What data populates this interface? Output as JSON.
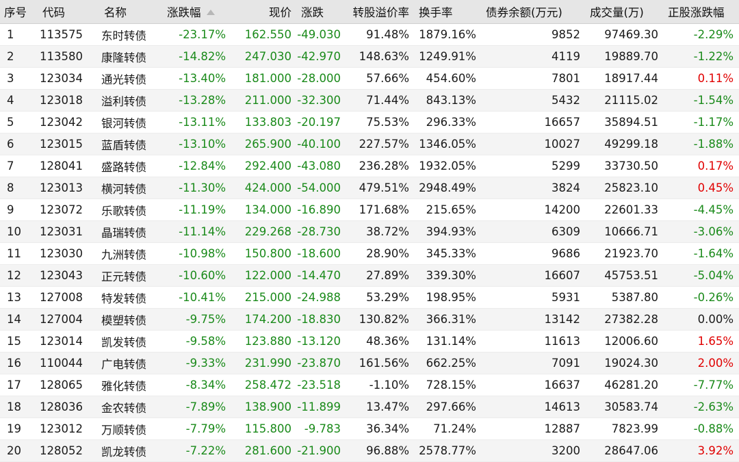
{
  "headers": [
    "序号",
    "代码",
    "名称",
    "涨跌幅",
    "现价",
    "涨跌",
    "转股溢价率",
    "换手率",
    "债券余额(万元)",
    "成交量(万)",
    "正股涨跌幅"
  ],
  "colors": {
    "down": "#1a8a1a",
    "up": "#e00000",
    "flat": "#1a1a1a"
  },
  "sort": {
    "column": "涨跌幅",
    "icon": "sort-ascending-icon"
  },
  "rows": [
    [
      "1",
      "113575",
      "东时转债",
      "-23.17%",
      "162.550",
      "-49.030",
      "91.48%",
      "1879.16%",
      "9852",
      "97469.30",
      "-2.29%"
    ],
    [
      "2",
      "113580",
      "康隆转债",
      "-14.82%",
      "247.030",
      "-42.970",
      "148.63%",
      "1249.91%",
      "4119",
      "19889.70",
      "-1.22%"
    ],
    [
      "3",
      "123034",
      "通光转债",
      "-13.40%",
      "181.000",
      "-28.000",
      "57.66%",
      "454.60%",
      "7801",
      "18917.44",
      "0.11%"
    ],
    [
      "4",
      "123018",
      "溢利转债",
      "-13.28%",
      "211.000",
      "-32.300",
      "71.44%",
      "843.13%",
      "5432",
      "21115.02",
      "-1.54%"
    ],
    [
      "5",
      "123042",
      "银河转债",
      "-13.11%",
      "133.803",
      "-20.197",
      "75.53%",
      "296.33%",
      "16657",
      "35894.51",
      "-1.17%"
    ],
    [
      "6",
      "123015",
      "蓝盾转债",
      "-13.10%",
      "265.900",
      "-40.100",
      "227.57%",
      "1346.05%",
      "10027",
      "49299.18",
      "-1.88%"
    ],
    [
      "7",
      "128041",
      "盛路转债",
      "-12.84%",
      "292.400",
      "-43.080",
      "236.28%",
      "1932.05%",
      "5299",
      "33730.50",
      "0.17%"
    ],
    [
      "8",
      "123013",
      "横河转债",
      "-11.30%",
      "424.000",
      "-54.000",
      "479.51%",
      "2948.49%",
      "3824",
      "25823.10",
      "0.45%"
    ],
    [
      "9",
      "123072",
      "乐歌转债",
      "-11.19%",
      "134.000",
      "-16.890",
      "171.68%",
      "215.65%",
      "14200",
      "22601.33",
      "-4.45%"
    ],
    [
      "10",
      "123031",
      "晶瑞转债",
      "-11.14%",
      "229.268",
      "-28.730",
      "38.72%",
      "394.93%",
      "6309",
      "10666.71",
      "-3.06%"
    ],
    [
      "11",
      "123030",
      "九洲转债",
      "-10.98%",
      "150.800",
      "-18.600",
      "28.90%",
      "345.33%",
      "9686",
      "21923.70",
      "-1.64%"
    ],
    [
      "12",
      "123043",
      "正元转债",
      "-10.60%",
      "122.000",
      "-14.470",
      "27.89%",
      "339.30%",
      "16607",
      "45753.51",
      "-5.04%"
    ],
    [
      "13",
      "127008",
      "特发转债",
      "-10.41%",
      "215.000",
      "-24.988",
      "53.29%",
      "198.95%",
      "5931",
      "5387.80",
      "-0.26%"
    ],
    [
      "14",
      "127004",
      "模塑转债",
      "-9.75%",
      "174.200",
      "-18.830",
      "130.82%",
      "366.31%",
      "13142",
      "27382.28",
      "0.00%"
    ],
    [
      "15",
      "123014",
      "凯发转债",
      "-9.58%",
      "123.880",
      "-13.120",
      "48.36%",
      "131.14%",
      "11613",
      "12006.60",
      "1.65%"
    ],
    [
      "16",
      "110044",
      "广电转债",
      "-9.33%",
      "231.990",
      "-23.870",
      "161.56%",
      "662.25%",
      "7091",
      "19024.30",
      "2.00%"
    ],
    [
      "17",
      "128065",
      "雅化转债",
      "-8.34%",
      "258.472",
      "-23.518",
      "-1.10%",
      "728.15%",
      "16637",
      "46281.20",
      "-7.77%"
    ],
    [
      "18",
      "128036",
      "金农转债",
      "-7.89%",
      "138.900",
      "-11.899",
      "13.47%",
      "297.66%",
      "14613",
      "30583.74",
      "-2.63%"
    ],
    [
      "19",
      "123012",
      "万顺转债",
      "-7.79%",
      "115.800",
      "-9.783",
      "36.34%",
      "71.24%",
      "12887",
      "7823.99",
      "-0.88%"
    ],
    [
      "20",
      "128052",
      "凯龙转债",
      "-7.22%",
      "281.600",
      "-21.900",
      "96.88%",
      "2578.77%",
      "3200",
      "28647.06",
      "3.92%"
    ]
  ]
}
